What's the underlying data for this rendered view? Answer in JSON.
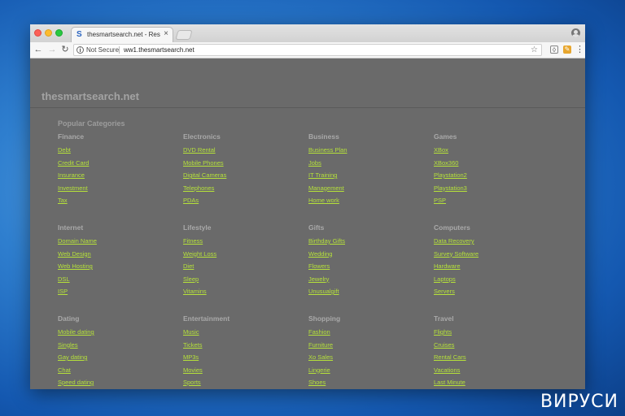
{
  "browser": {
    "tab_title": "thesmartsearch.net - Resource",
    "tab_close": "×",
    "security_label": "Not Secure",
    "url": "ww1.thesmartsearch.net"
  },
  "icons": {
    "back": "←",
    "forward": "→",
    "reload": "↻",
    "info": "i",
    "star": "☆",
    "menu": "⋮",
    "favicon": "S"
  },
  "page": {
    "site_title": "thesmartsearch.net",
    "section_heading": "Popular Categories",
    "categories": [
      {
        "name": "Finance",
        "links": [
          "Debt",
          "Credit Card",
          "Insurance",
          "Investment",
          "Tax"
        ]
      },
      {
        "name": "Electronics",
        "links": [
          "DVD Rental",
          "Mobile Phones",
          "Digital Cameras",
          "Telephones",
          "PDAs"
        ]
      },
      {
        "name": "Business",
        "links": [
          "Business Plan",
          "Jobs",
          "IT Training",
          "Management",
          "Home work"
        ]
      },
      {
        "name": "Games",
        "links": [
          "XBox",
          "XBox360",
          "Playstation2",
          "Playstation3",
          "PSP"
        ]
      },
      {
        "name": "Internet",
        "links": [
          "Domain Name",
          "Web Design",
          "Web Hosting",
          "DSL",
          "ISP"
        ]
      },
      {
        "name": "Lifestyle",
        "links": [
          "Fitness",
          "Weight Loss",
          "Diet",
          "Sleep",
          "Vitamins"
        ]
      },
      {
        "name": "Gifts",
        "links": [
          "Birthday Gifts",
          "Wedding",
          "Flowers",
          "Jewelry",
          "Unusualgift"
        ]
      },
      {
        "name": "Computers",
        "links": [
          "Data Recovery",
          "Survey Software",
          "Hardware",
          "Laptops",
          "Servers"
        ]
      },
      {
        "name": "Dating",
        "links": [
          "Mobile dating",
          "Singles",
          "Gay dating",
          "Chat",
          "Speed dating"
        ]
      },
      {
        "name": "Entertainment",
        "links": [
          "Music",
          "Tickets",
          "MP3s",
          "Movies",
          "Sports"
        ]
      },
      {
        "name": "Shopping",
        "links": [
          "Fashion",
          "Furniture",
          "Xo Sales",
          "Lingerie",
          "Shoes"
        ]
      },
      {
        "name": "Travel",
        "links": [
          "Flights",
          "Cruises",
          "Rental Cars",
          "Vacations",
          "Last Minute"
        ]
      }
    ]
  },
  "watermark": {
    "text": "ВИРУСИ"
  },
  "colors": {
    "link": "#b6e23a",
    "page_background": "#6a6a6a",
    "desktop_blue": "#2f7fcf"
  }
}
